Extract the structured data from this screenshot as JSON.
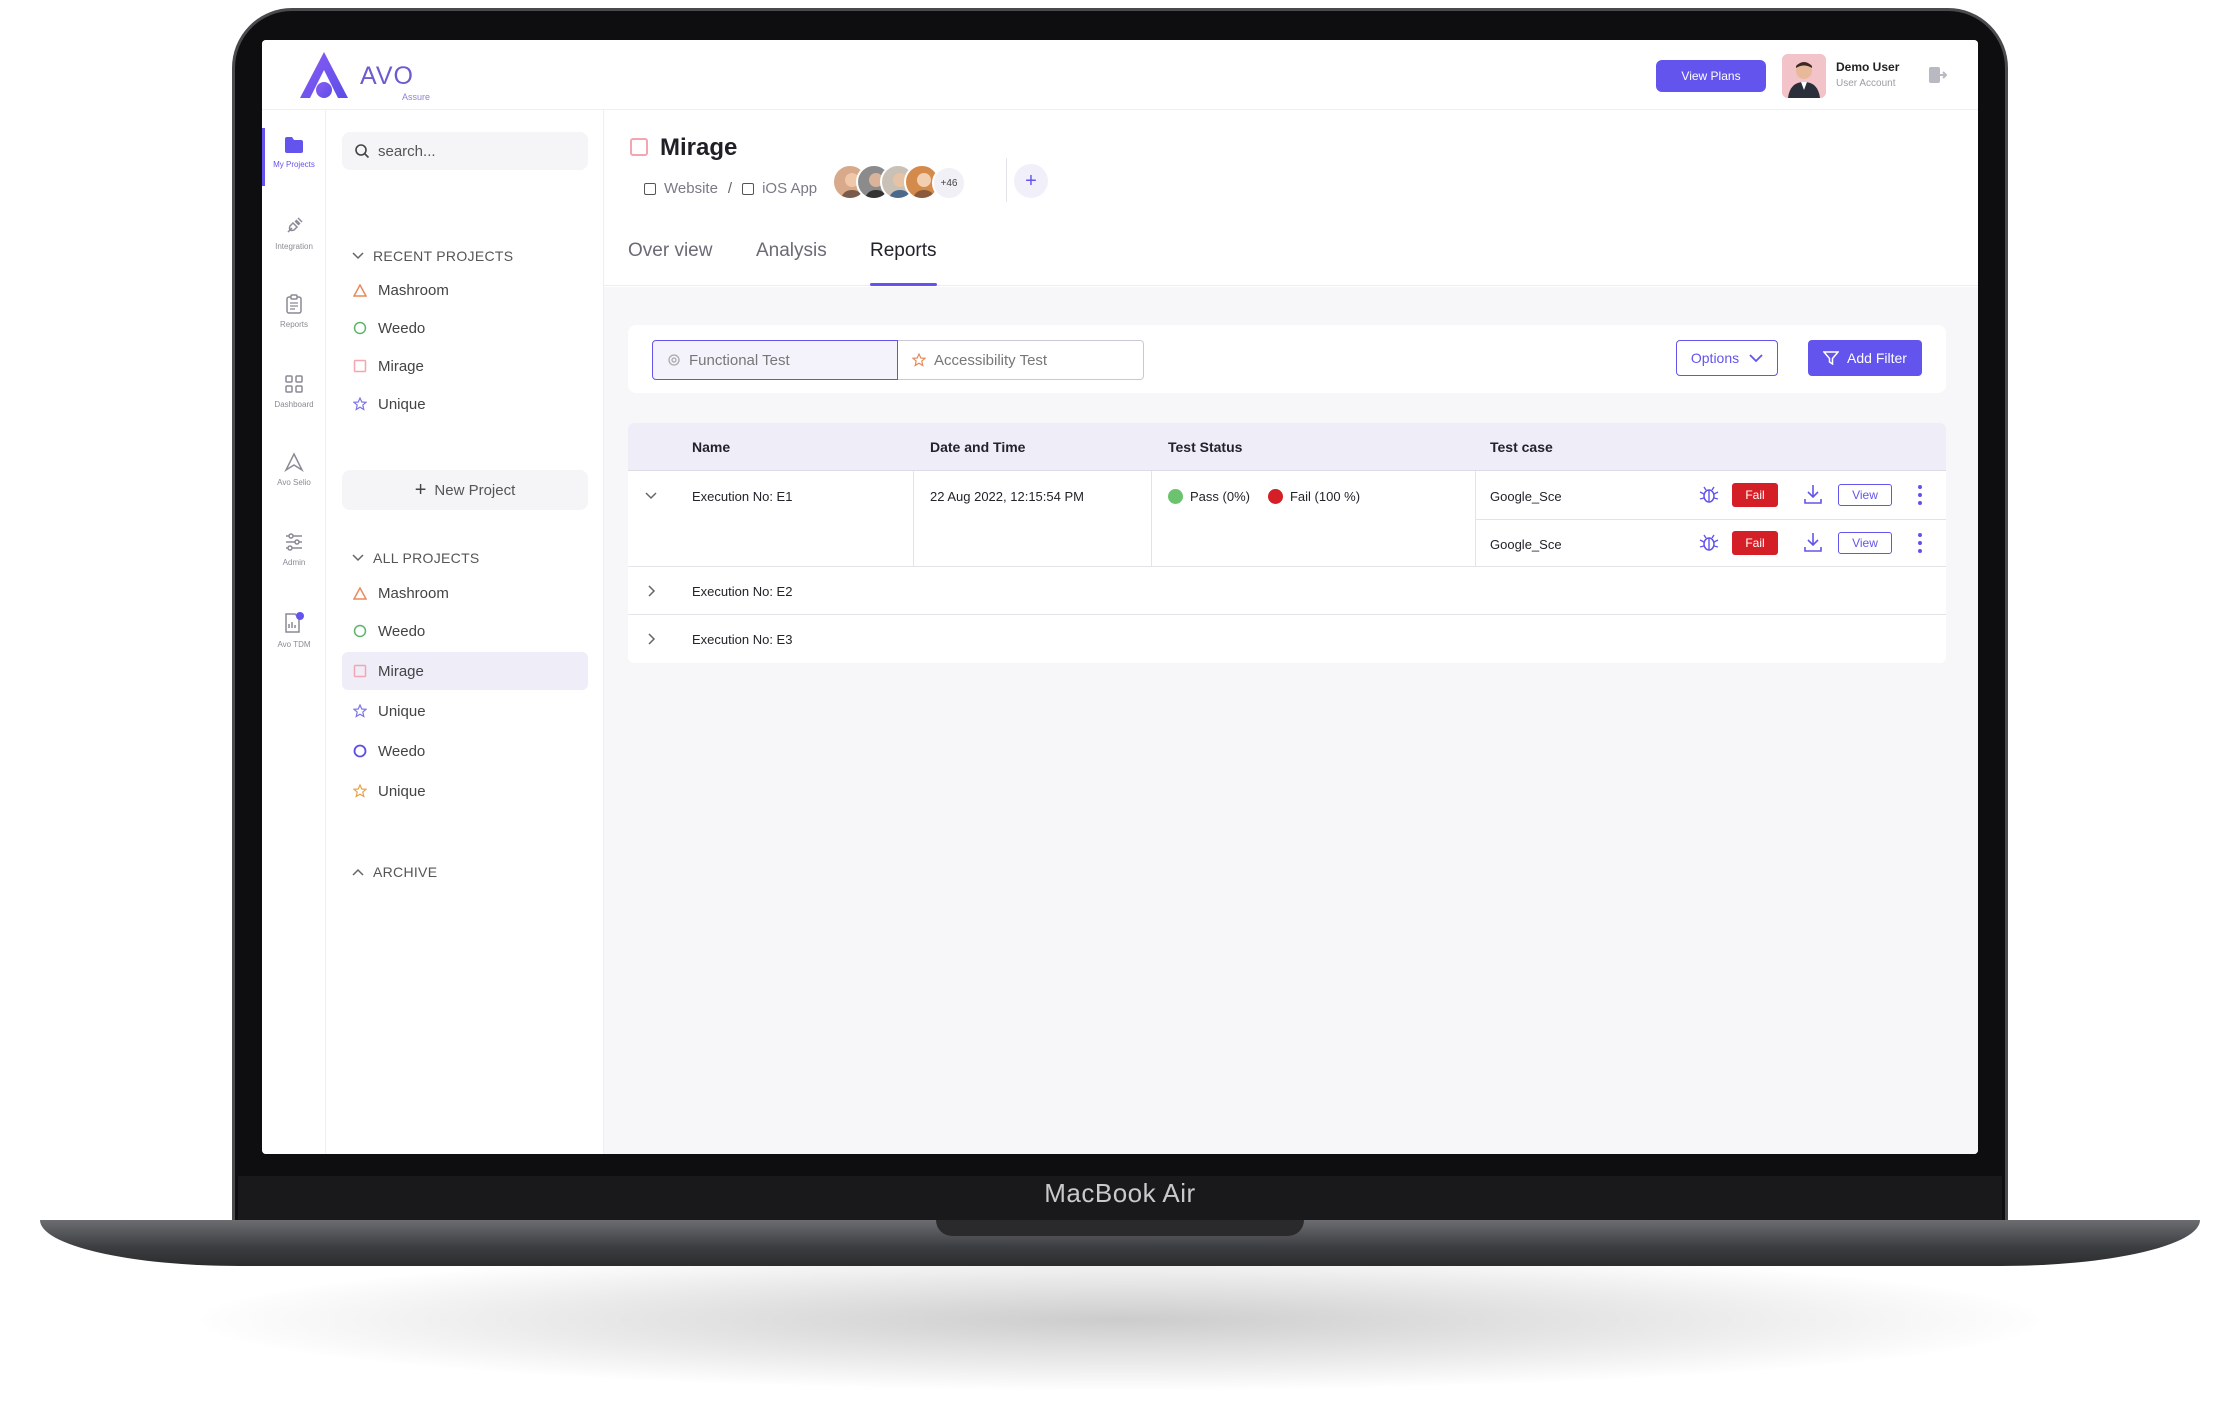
{
  "device": {
    "label": "MacBook Air"
  },
  "app": {
    "logo_text": "AVO",
    "logo_sub": "Assure",
    "view_plans": "View Plans",
    "user_name": "Demo User",
    "user_role": "User Account",
    "brand_color": "#6354EE"
  },
  "rail": [
    {
      "label": "My Projects",
      "icon": "folder-icon",
      "active": true
    },
    {
      "label": "Integration",
      "icon": "plug-icon"
    },
    {
      "label": "Reports",
      "icon": "clipboard-icon"
    },
    {
      "label": "Dashboard",
      "icon": "grid-icon"
    },
    {
      "label": "Avo Selio",
      "icon": "avo-icon"
    },
    {
      "label": "Admin",
      "icon": "sliders-icon"
    },
    {
      "label": "Avo TDM",
      "icon": "tdm-icon"
    }
  ],
  "sidebar": {
    "search_placeholder": "search...",
    "recent_title": "RECENT PROJECTS",
    "recent": [
      {
        "name": "Mashroom",
        "icon": "triangle"
      },
      {
        "name": "Weedo",
        "icon": "circle"
      },
      {
        "name": "Mirage",
        "icon": "square"
      },
      {
        "name": "Unique",
        "icon": "star"
      }
    ],
    "new_project": "New Project",
    "all_title": "ALL PROJECTS",
    "all": [
      {
        "name": "Mashroom",
        "icon": "triangle"
      },
      {
        "name": "Weedo",
        "icon": "circle"
      },
      {
        "name": "Mirage",
        "icon": "square",
        "selected": true
      },
      {
        "name": "Unique",
        "icon": "star"
      },
      {
        "name": "Weedo",
        "icon": "circle"
      },
      {
        "name": "Unique",
        "icon": "star"
      }
    ],
    "archive_title": "ARCHIVE"
  },
  "project": {
    "title": "Mirage",
    "crumb_1": "Website",
    "crumb_sep": "/",
    "crumb_2": "iOS App",
    "more_members": "+46",
    "tabs": [
      "Over view",
      "Analysis",
      "Reports"
    ],
    "active_tab": "Reports"
  },
  "filters": {
    "functional": "Functional Test",
    "accessibility": "Accessibility Test",
    "options": "Options",
    "add_filter": "Add Filter"
  },
  "table": {
    "headers": {
      "name": "Name",
      "date": "Date and Time",
      "status": "Test Status",
      "testcase": "Test case"
    },
    "rows": [
      {
        "name": "Execution No: E1",
        "date": "22 Aug 2022, 12:15:54 PM",
        "pass": "Pass (0%)",
        "fail": "Fail (100 %)",
        "testcases": [
          {
            "name": "Google_Sce",
            "badge": "Fail",
            "view": "View"
          },
          {
            "name": "Google_Sce",
            "badge": "Fail",
            "view": "View"
          }
        ]
      },
      {
        "name": "Execution No: E2"
      },
      {
        "name": "Execution No: E3"
      }
    ]
  },
  "colors": {
    "pass": "#6BC46D",
    "fail": "#D51F26",
    "accent": "#6354EE"
  }
}
